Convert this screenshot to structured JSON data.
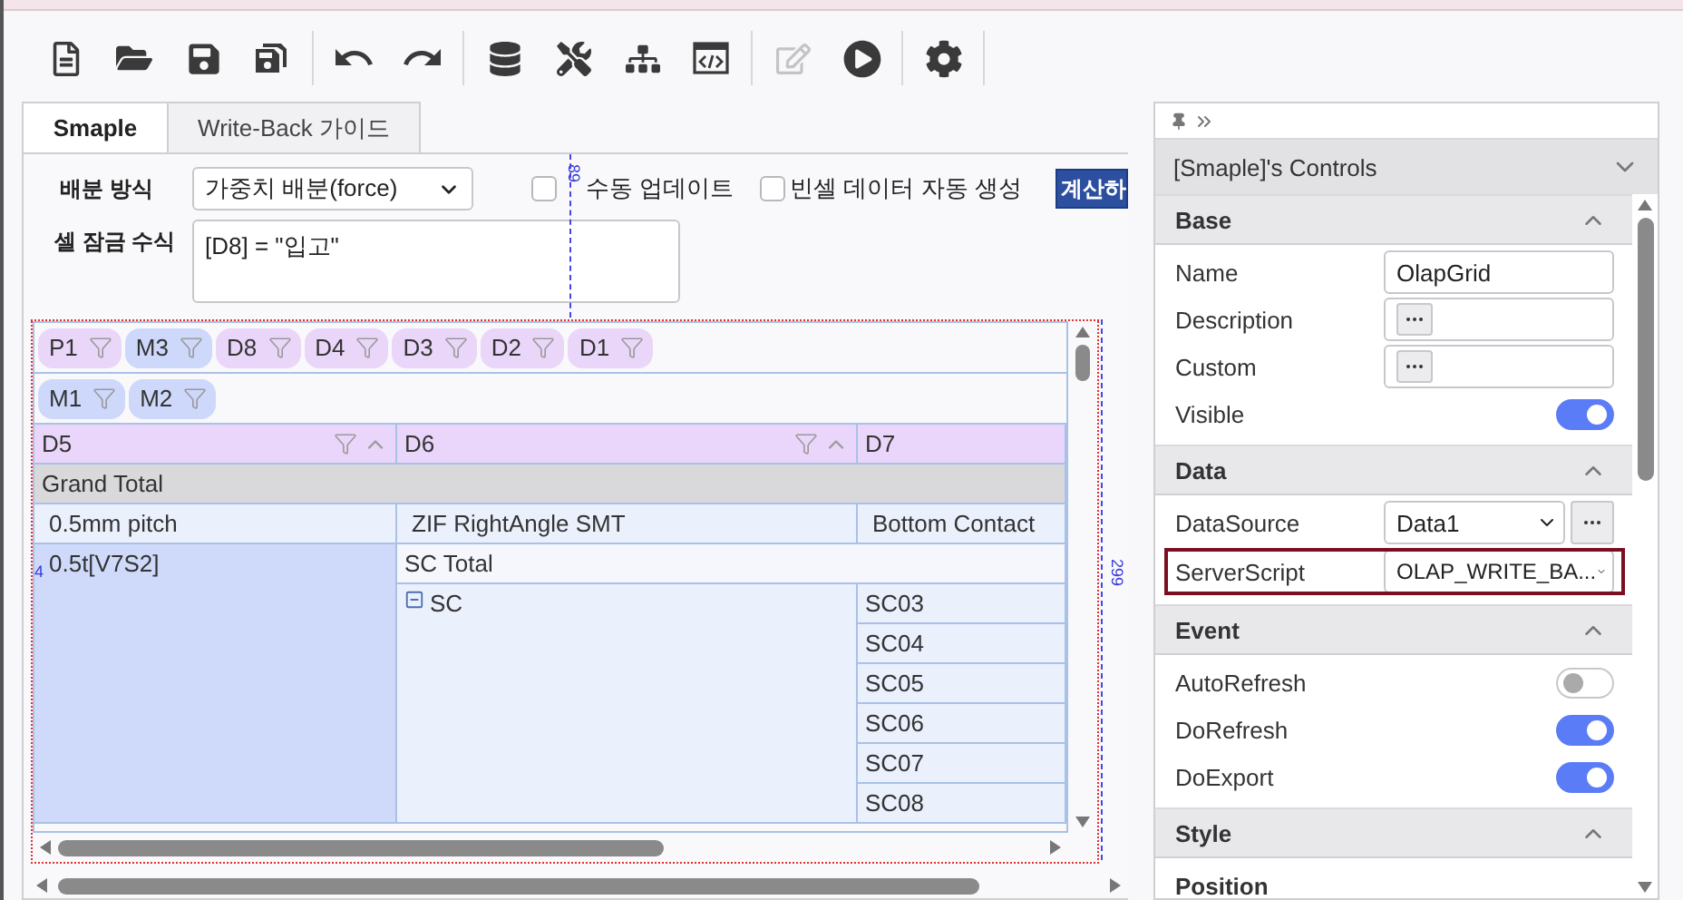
{
  "toolbar": [
    [
      {
        "kind": "new",
        "disabled": false
      },
      {
        "kind": "open",
        "disabled": false
      },
      {
        "kind": "save",
        "disabled": false
      },
      {
        "kind": "save_all",
        "disabled": false
      }
    ],
    [
      {
        "kind": "undo",
        "disabled": false
      },
      {
        "kind": "redo",
        "disabled": false
      }
    ],
    [
      {
        "kind": "database",
        "disabled": false
      },
      {
        "kind": "tools",
        "disabled": false
      },
      {
        "kind": "tree",
        "disabled": false
      },
      {
        "kind": "code",
        "disabled": false
      }
    ],
    [
      {
        "kind": "edit",
        "disabled": true
      },
      {
        "kind": "run",
        "disabled": false
      }
    ],
    [
      {
        "kind": "settings",
        "disabled": false
      }
    ]
  ],
  "tabs": [
    {
      "label": "Smaple",
      "selected": true
    },
    {
      "label": "Write-Back 가이드",
      "selected": false
    }
  ],
  "form": {
    "method_label": "배분 방식",
    "method_value": "가중치 배분(force)",
    "checkboxes": [
      {
        "label": "수동 업데이트",
        "checked": false
      },
      {
        "label": "빈셀 데이터 자동 생성",
        "checked": false
      }
    ],
    "calc_button": "계산하",
    "lock_label": "셀 잠금 수식",
    "lock_value": "[D8] = \"입고\""
  },
  "design_guides": [
    {
      "kind": "top",
      "label": "89"
    },
    {
      "kind": "right",
      "label": "299"
    },
    {
      "kind": "left",
      "label": "4"
    }
  ],
  "pivot": {
    "filter_chips": [
      {
        "label": "P1",
        "color": "#e9d6f9"
      },
      {
        "label": "M3",
        "color": "#cdd8fb"
      },
      {
        "label": "D8",
        "color": "#e9d6f9"
      },
      {
        "label": "D4",
        "color": "#e9d6f9"
      },
      {
        "label": "D3",
        "color": "#e9d6f9"
      },
      {
        "label": "D2",
        "color": "#e9d6f9"
      },
      {
        "label": "D1",
        "color": "#e9d6f9"
      }
    ],
    "row_chips": [
      {
        "label": "M1",
        "color": "#cdd8fb"
      },
      {
        "label": "M2",
        "color": "#cdd8fb"
      }
    ],
    "columns": [
      {
        "label": "D5",
        "filter": true
      },
      {
        "label": "D6",
        "filter": true
      },
      {
        "label": "D7",
        "filter": false
      }
    ],
    "grand_total": "Grand Total",
    "header_row": [
      "0.5mm pitch",
      "ZIF RightAngle SMT",
      "Bottom Contact"
    ],
    "group": {
      "label": "0.5t[V7S2]",
      "total": "SC Total",
      "node": {
        "label": "SC",
        "expanded": true,
        "items": [
          "SC03",
          "SC04",
          "SC05",
          "SC06",
          "SC07",
          "SC08"
        ]
      }
    }
  },
  "properties": {
    "title": "[Smaple]'s Controls",
    "expanded": true,
    "sections": [
      {
        "title": "Base",
        "expanded": true,
        "items": [
          {
            "kind": "text",
            "label": "Name",
            "value": "OlapGrid",
            "highlighted": false
          },
          {
            "kind": "ellipsis",
            "label": "Description",
            "highlighted": false
          },
          {
            "kind": "ellipsis",
            "label": "Custom",
            "highlighted": false
          },
          {
            "kind": "toggle",
            "label": "Visible",
            "on": true,
            "highlighted": false
          }
        ]
      },
      {
        "title": "Data",
        "expanded": true,
        "items": [
          {
            "kind": "select_ellipsis",
            "label": "DataSource",
            "value": "Data1",
            "highlighted": false
          },
          {
            "kind": "select",
            "label": "ServerScript",
            "value": "OLAP_WRITE_BA...",
            "highlighted": true
          }
        ]
      },
      {
        "title": "Event",
        "expanded": true,
        "items": [
          {
            "kind": "toggle",
            "label": "AutoRefresh",
            "on": false,
            "highlighted": false
          },
          {
            "kind": "toggle",
            "label": "DoRefresh",
            "on": true,
            "highlighted": false
          },
          {
            "kind": "toggle",
            "label": "DoExport",
            "on": true,
            "highlighted": false
          }
        ]
      },
      {
        "title": "Style",
        "expanded": true,
        "items": [
          {
            "kind": "group",
            "label": "Position",
            "highlighted": false
          }
        ]
      }
    ]
  }
}
